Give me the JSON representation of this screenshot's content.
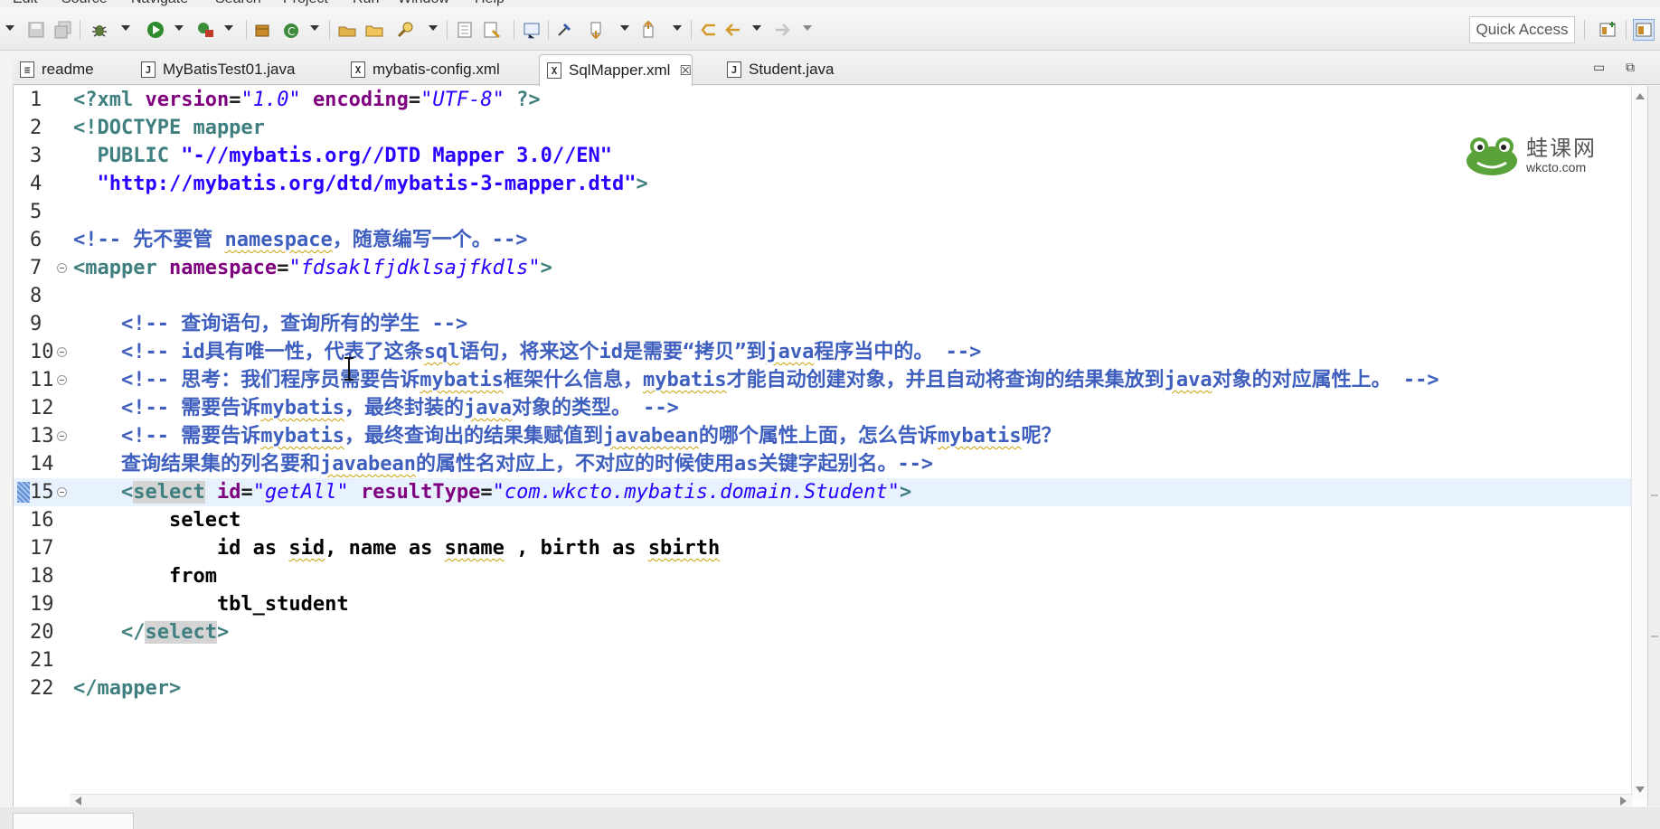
{
  "menubar": {
    "items": [
      "Edit",
      "Source",
      "Navigate",
      "Search",
      "Project",
      "Run",
      "Window",
      "Help"
    ]
  },
  "toolbar": {
    "quick_access": "Quick Access"
  },
  "tabs": [
    {
      "label": "readme",
      "icon": "text-file-icon",
      "active": false
    },
    {
      "label": "MyBatisTest01.java",
      "icon": "java-file-icon",
      "active": false
    },
    {
      "label": "mybatis-config.xml",
      "icon": "xml-file-icon",
      "active": false
    },
    {
      "label": "SqlMapper.xml",
      "icon": "xml-file-icon",
      "active": true
    },
    {
      "label": "Student.java",
      "icon": "java-file-icon",
      "active": false
    }
  ],
  "editor": {
    "line_numbers": [
      "1",
      "2",
      "3",
      "4",
      "5",
      "6",
      "7",
      "8",
      "9",
      "10",
      "11",
      "12",
      "13",
      "14",
      "15",
      "16",
      "17",
      "18",
      "19",
      "20",
      "21",
      "22"
    ],
    "current_line": 15
  },
  "watermark": {
    "cn": "蛙课网",
    "en": "wkcto.com"
  },
  "colors": {
    "comment": "#3f5fbf",
    "tag": "#3f7f7f",
    "attribute": "#7f007f",
    "value": "#2a00ff",
    "current_line": "#e8f2fe"
  }
}
